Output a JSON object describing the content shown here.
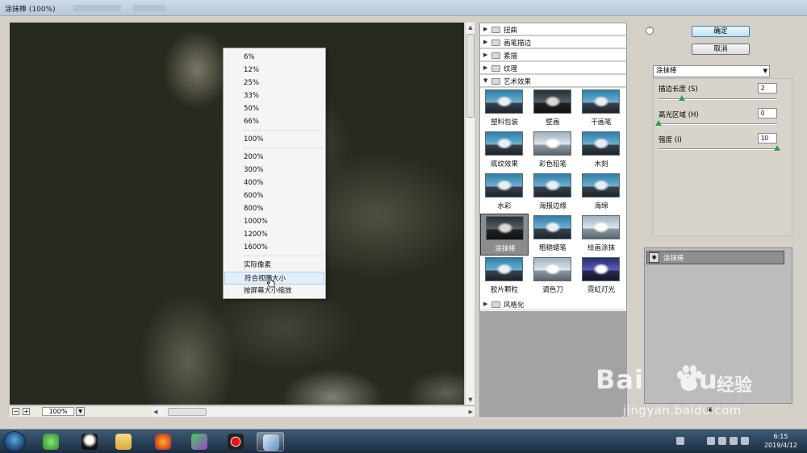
{
  "window": {
    "title": "涂抹棒 (100%)"
  },
  "zoom_menu": {
    "group1": [
      "6%",
      "12%",
      "25%",
      "33%",
      "50%",
      "66%"
    ],
    "group2": [
      "100%"
    ],
    "group3": [
      "200%",
      "300%",
      "400%",
      "600%",
      "800%",
      "1000%",
      "1200%",
      "1600%"
    ],
    "group4": [
      "实际像素",
      "符合视图大小",
      "按屏幕大小缩放"
    ],
    "highlighted": "符合视图大小"
  },
  "zoom_bar": {
    "minus": "−",
    "plus": "+",
    "value": "100%"
  },
  "gallery": {
    "categories": [
      "扭曲",
      "画笔描边",
      "素描",
      "纹理",
      "艺术效果"
    ],
    "expanded_category": "艺术效果",
    "filters": [
      {
        "label": "塑料包装",
        "style": "blue"
      },
      {
        "label": "壁画",
        "style": "dark"
      },
      {
        "label": "干画笔",
        "style": "blue"
      },
      {
        "label": "底纹效果",
        "style": "blue"
      },
      {
        "label": "彩色铅笔",
        "style": "light"
      },
      {
        "label": "木刻",
        "style": "blue"
      },
      {
        "label": "水彩",
        "style": "blue"
      },
      {
        "label": "海报边缘",
        "style": "blue"
      },
      {
        "label": "海绵",
        "style": "blue"
      },
      {
        "label": "涂抹棒",
        "style": "dark",
        "selected": true
      },
      {
        "label": "粗糙蜡笔",
        "style": "blue"
      },
      {
        "label": "绘画涂抹",
        "style": "light"
      },
      {
        "label": "胶片颗粒",
        "style": "blue"
      },
      {
        "label": "调色刀",
        "style": "light"
      },
      {
        "label": "霓虹灯光",
        "style": "purple"
      }
    ],
    "last_category": "风格化"
  },
  "buttons": {
    "ok": "确定",
    "cancel": "取消"
  },
  "filter_select": {
    "value": "涂抹棒"
  },
  "params": [
    {
      "label": "描边长度 (S)",
      "value": "2",
      "fraction": 0.2
    },
    {
      "label": "高光区域 (H)",
      "value": "0",
      "fraction": 0.0
    },
    {
      "label": "强度 (I)",
      "value": "10",
      "fraction": 1.0
    }
  ],
  "layer": {
    "name": "涂抹棒"
  },
  "watermark": {
    "brand": "Bai",
    "brand2": "du",
    "cn": "经验",
    "url": "jingyan.baidu.com"
  },
  "taskbar": {
    "time": "6:15",
    "date": "2019/4/12"
  },
  "colors": {
    "title_bar": "#c7d5e4",
    "selected_thumb": "#8c8c8c",
    "ok_button": "#bfe0f5",
    "slider_knob": "#2f9e4e"
  }
}
